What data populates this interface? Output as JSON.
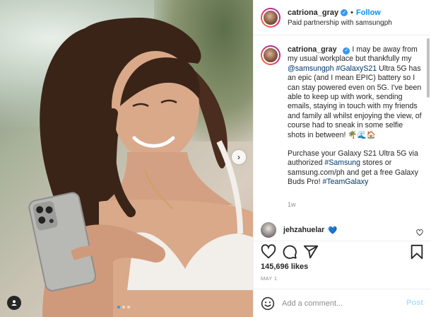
{
  "post": {
    "username": "catriona_gray",
    "follow_label": "Follow",
    "separator": "•",
    "partnership": "Paid partnership with samsungph",
    "caption": {
      "part1": "I may be away from my usual workplace but thankfully my ",
      "mention": "@samsungph",
      "space1": " ",
      "hashtag1": "#GalaxyS21",
      "part2": " Ultra 5G has an epic (and I mean EPIC) battery so I can stay powered even on 5G. I've been able to keep up with work, sending emails, staying in touch with my friends and family all whilst enjoying the view, of course had to sneak in some selfie shots in between! ",
      "emojis": "🌴🌊🏠",
      "part3": "Purchase your Galaxy S21 Ultra 5G via authorized ",
      "hashtag2": "#Samsung",
      "part4": " stores or samsung.com/ph and get a free Galaxy Buds Pro! ",
      "hashtag3": "#TeamGalaxy"
    },
    "caption_age": "1w",
    "comment": {
      "username": "jehzahuelar",
      "emoji": "💙"
    },
    "likes": "145,696 likes",
    "date": "MAY 1",
    "add_comment_placeholder": "Add a comment...",
    "post_button": "Post",
    "carousel": {
      "count": 3,
      "active": 0
    }
  },
  "icons": {
    "verified": "verified-badge-icon",
    "heart": "heart-icon",
    "comment": "comment-icon",
    "share": "share-icon",
    "save": "bookmark-icon",
    "emoji": "emoji-icon",
    "next": "chevron-right-icon",
    "tag": "user-tag-icon"
  },
  "colors": {
    "link": "#00376b",
    "follow": "#0095f6",
    "verified": "#3897f0",
    "post_disabled": "#b2dffc"
  }
}
